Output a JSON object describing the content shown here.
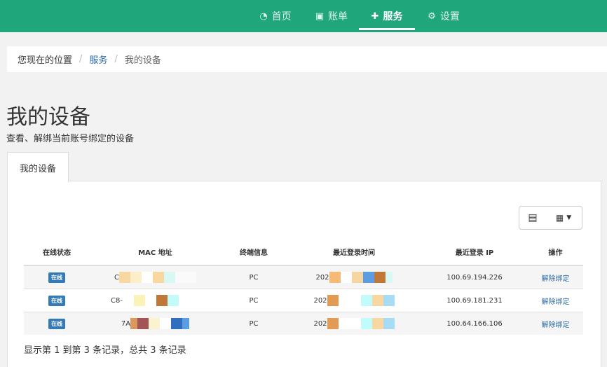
{
  "nav": [
    {
      "label": "首页",
      "icon": "dashboard-icon"
    },
    {
      "label": "账单",
      "icon": "bill-icon"
    },
    {
      "label": "服务",
      "icon": "puzzle-icon",
      "active": true
    },
    {
      "label": "设置",
      "icon": "gear-icon"
    }
  ],
  "breadcrumb": {
    "prefix": "您现在的位置",
    "sep": "/",
    "level1": "服务",
    "level2": "我的设备"
  },
  "page": {
    "title": "我的设备",
    "subtitle": "查看、解绑当前账号绑定的设备"
  },
  "tab": {
    "label": "我的设备"
  },
  "toolbar": {
    "list_icon": "list-icon",
    "grid_icon": "grid-icon"
  },
  "table": {
    "headers": [
      "在线状态",
      "MAC 地址",
      "终端信息",
      "最近登录时间",
      "最近登录 IP",
      "操作"
    ],
    "rows": [
      {
        "status": "在线",
        "mac": "C",
        "terminal": "PC",
        "time": "202",
        "ip": "100.69.194.226",
        "action": "解除绑定"
      },
      {
        "status": "在线",
        "mac": "C8-",
        "terminal": "PC",
        "time": "202",
        "ip": "100.69.181.231",
        "action": "解除绑定"
      },
      {
        "status": "在线",
        "mac": "7A",
        "terminal": "PC",
        "time": "202",
        "ip": "100.64.166.106",
        "action": "解除绑定"
      }
    ]
  },
  "footer": "显示第 1 到第 3 条记录，总共 3 条记录",
  "colors": {
    "primary": "#1fa67a",
    "link": "#2c6aa8",
    "badge": "#337ab7"
  }
}
